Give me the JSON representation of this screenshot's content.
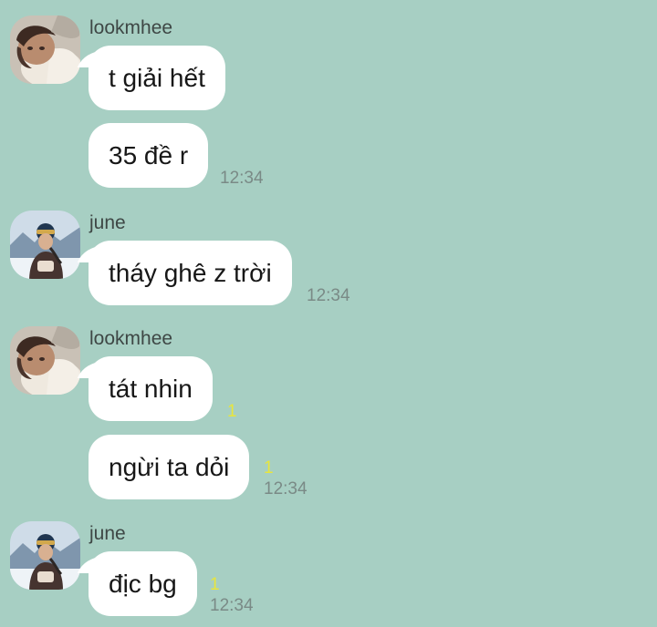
{
  "messages": [
    {
      "sender": "lookmhee",
      "avatar": "lookmhee-avatar",
      "bubbles": [
        {
          "text": "t giải hết",
          "unread": "",
          "time": ""
        },
        {
          "text": "35 đề r",
          "unread": "",
          "time": "12:34"
        }
      ]
    },
    {
      "sender": "june",
      "avatar": "june-avatar",
      "bubbles": [
        {
          "text": "tháy ghê z trời",
          "unread": "",
          "time": "12:34"
        }
      ]
    },
    {
      "sender": "lookmhee",
      "avatar": "lookmhee-avatar",
      "bubbles": [
        {
          "text": "tát nhin",
          "unread": "1",
          "time": ""
        },
        {
          "text": "ngừi ta dỏi",
          "unread": "1",
          "time": "12:34"
        }
      ]
    },
    {
      "sender": "june",
      "avatar": "june-avatar",
      "bubbles": [
        {
          "text": "địc bg",
          "unread": "1",
          "time": "12:34"
        }
      ]
    }
  ],
  "colors": {
    "background": "#a7cfc3",
    "bubble": "#ffffff",
    "unread": "#e8e63c",
    "timestamp": "#7a8a86"
  }
}
